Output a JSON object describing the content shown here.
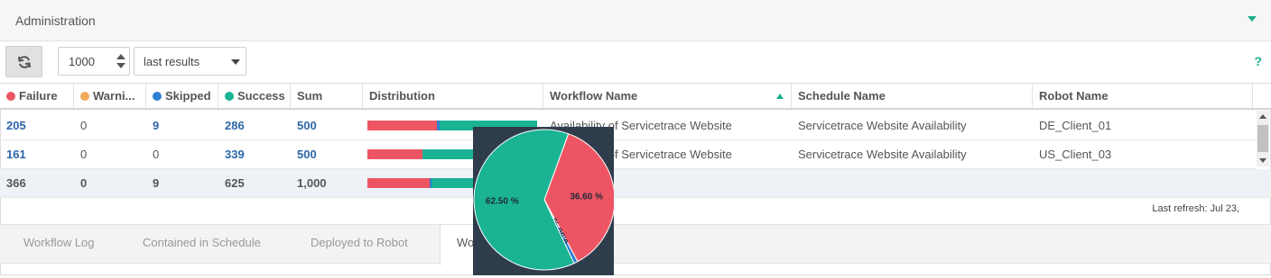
{
  "header": {
    "title": "Administration"
  },
  "toolbar": {
    "count_value": "1000",
    "results_select": "last results",
    "help_label": "?"
  },
  "columns": {
    "failure": "Failure",
    "warning": "Warni...",
    "skipped": "Skipped",
    "success": "Success",
    "sum": "Sum",
    "distribution": "Distribution",
    "workflow": "Workflow Name",
    "schedule": "Schedule Name",
    "robot": "Robot Name"
  },
  "status_colors": {
    "failure": "#ee5564",
    "warning": "#f3a95c",
    "skipped": "#2f7fd0",
    "success": "#1ab394"
  },
  "rows": [
    {
      "failure": "205",
      "warning": "0",
      "skipped": "9",
      "success": "286",
      "sum": "500",
      "distribution": {
        "failure": 205,
        "skipped": 9,
        "success": 286,
        "total": 500
      },
      "workflow": "Availability of Servicetrace Website",
      "schedule": "Servicetrace Website Availability",
      "robot": "DE_Client_01"
    },
    {
      "failure": "161",
      "warning": "0",
      "skipped": "0",
      "success": "339",
      "sum": "500",
      "distribution": {
        "failure": 161,
        "skipped": 0,
        "success": 339,
        "total": 500
      },
      "workflow": "Availability of Servicetrace Website",
      "schedule": "Servicetrace Website Availability",
      "robot": "US_Client_03"
    }
  ],
  "totals": {
    "failure": "366",
    "warning": "0",
    "skipped": "9",
    "success": "625",
    "sum": "1,000",
    "distribution": {
      "failure": 366,
      "skipped": 9,
      "success": 625,
      "total": 1000
    }
  },
  "last_refresh": "Last refresh: Jul 23,",
  "tabs": [
    "Workflow Log",
    "Contained in Schedule",
    "Deployed to Robot",
    "Wo"
  ],
  "tooltip": {
    "slices": [
      {
        "label": "36.60 %",
        "value": 36.6,
        "color": "#ee5564"
      },
      {
        "label": "0.90 %",
        "value": 0.9,
        "color": "#2f7fd0"
      },
      {
        "label": "62.50 %",
        "value": 62.5,
        "color": "#1ab394"
      }
    ]
  }
}
